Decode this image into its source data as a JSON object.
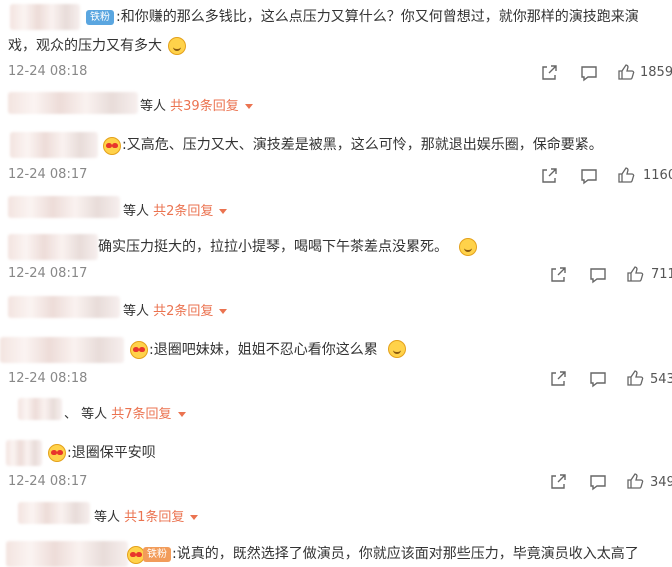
{
  "comments": [
    {
      "badge": "铁粉",
      "text_line1": ":和你赚的那么多钱比，这么点压力又算什么？你又何曾想过，就你那样的演技跑来演",
      "text_line2": "戏，观众的压力又有多大",
      "time": "12-24 08:18",
      "likes": "1859",
      "replies_prefix": "等人",
      "replies_count": "共39条回复"
    },
    {
      "text": ":又高危、压力又大、演技差是被黑，这么可怜，那就退出娱乐圈，保命要紧。",
      "time": "12-24 08:17",
      "likes": "1160",
      "replies_prefix": "等人",
      "replies_count": "共2条回复"
    },
    {
      "text": "确实压力挺大的，拉拉小提琴，喝喝下午茶差点没累死。",
      "time": "12-24 08:17",
      "likes": "711",
      "replies_prefix": "等人",
      "replies_count": "共2条回复"
    },
    {
      "text": ":退圈吧妹妹，姐姐不忍心看你这么累",
      "time": "12-24 08:18",
      "likes": "543",
      "replies_prefix": "、 等人",
      "replies_count": "共7条回复"
    },
    {
      "text": ":退圈保平安呗",
      "time": "12-24 08:17",
      "likes": "349",
      "replies_prefix": "等人",
      "replies_count": "共1条回复"
    },
    {
      "badge": "铁粉",
      "text": ":说真的，既然选择了做演员，你就应该面对那些压力，毕竟演员收入太高了"
    }
  ],
  "icons": {
    "share": "share-icon",
    "comment": "comment-icon",
    "like": "like-icon"
  },
  "colors": {
    "reply_accent": "#eb7350",
    "badge_blue": "#5aa6e0",
    "time_gray": "#888888"
  }
}
